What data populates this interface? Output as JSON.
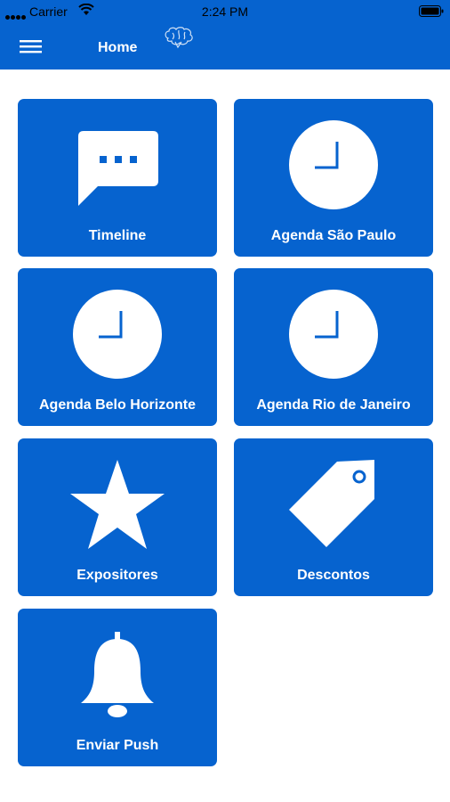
{
  "status_bar": {
    "carrier": "Carrier",
    "time": "2:24 PM"
  },
  "header": {
    "title": "Home",
    "background_color": "#0663cf"
  },
  "tiles": [
    {
      "label": "Timeline",
      "icon": "chat-bubble-icon"
    },
    {
      "label": "Agenda São Paulo",
      "icon": "clock-icon"
    },
    {
      "label": "Agenda Belo Horizonte",
      "icon": "clock-icon"
    },
    {
      "label": "Agenda Rio de Janeiro",
      "icon": "clock-icon"
    },
    {
      "label": "Expositores",
      "icon": "star-icon"
    },
    {
      "label": "Descontos",
      "icon": "tag-icon"
    },
    {
      "label": "Enviar Push",
      "icon": "bell-icon"
    }
  ]
}
